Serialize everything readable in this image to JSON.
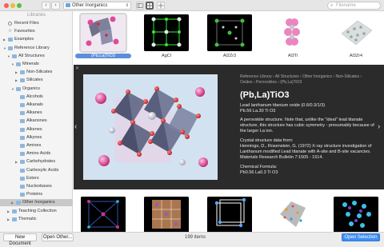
{
  "toolbar": {
    "back": "‹",
    "forward": "›",
    "location": "Other Inorganics",
    "search_placeholder": "Filename"
  },
  "sidebar": {
    "header": "Libraries",
    "items": [
      {
        "label": "Recent Files",
        "level": 0,
        "icon": "clock-icon"
      },
      {
        "label": "Favourites",
        "level": 0,
        "icon": "star-icon"
      },
      {
        "label": "Examples",
        "level": 0,
        "icon": "folder-icon",
        "collapsed": true
      },
      {
        "label": "Reference Library",
        "level": 0,
        "icon": "folder-icon",
        "expanded": true
      },
      {
        "label": "All Structures",
        "level": 1,
        "icon": "folder-icon",
        "expanded": true
      },
      {
        "label": "Minerals",
        "level": 2,
        "icon": "folder-icon",
        "expanded": true
      },
      {
        "label": "Non-Silicates",
        "level": 3,
        "icon": "folder-icon",
        "collapsed": true
      },
      {
        "label": "Silicates",
        "level": 3,
        "icon": "folder-icon",
        "collapsed": true
      },
      {
        "label": "Organics",
        "level": 2,
        "icon": "folder-icon",
        "expanded": true
      },
      {
        "label": "Alcohols",
        "level": 3,
        "icon": "folder-icon"
      },
      {
        "label": "Alkanals",
        "level": 3,
        "icon": "folder-icon"
      },
      {
        "label": "Alkanes",
        "level": 3,
        "icon": "folder-icon"
      },
      {
        "label": "Alkanones",
        "level": 3,
        "icon": "folder-icon"
      },
      {
        "label": "Alkenes",
        "level": 3,
        "icon": "folder-icon"
      },
      {
        "label": "Alkynes",
        "level": 3,
        "icon": "folder-icon"
      },
      {
        "label": "Amines",
        "level": 3,
        "icon": "folder-icon"
      },
      {
        "label": "Amino Acids",
        "level": 3,
        "icon": "folder-icon"
      },
      {
        "label": "Carbohydrates",
        "level": 3,
        "icon": "folder-icon",
        "collapsed": true
      },
      {
        "label": "Carboxylic Acids",
        "level": 3,
        "icon": "folder-icon"
      },
      {
        "label": "Esters",
        "level": 3,
        "icon": "folder-icon"
      },
      {
        "label": "Nucleobases",
        "level": 3,
        "icon": "folder-icon"
      },
      {
        "label": "Proteins",
        "level": 3,
        "icon": "folder-icon"
      },
      {
        "label": "Other Inorganics",
        "level": 2,
        "icon": "folder-icon",
        "selected": true,
        "collapsed": true
      },
      {
        "label": "Teaching Collection",
        "level": 1,
        "icon": "folder-icon",
        "collapsed": true
      },
      {
        "label": "Thematic",
        "level": 1,
        "icon": "folder-icon",
        "collapsed": true
      }
    ]
  },
  "thumbnails_top": [
    {
      "label": "(Pb,La)TiO3",
      "selected": true
    },
    {
      "label": "AgCl"
    },
    {
      "label": "Al2Zr3"
    },
    {
      "label": "Al3Ti"
    },
    {
      "label": "Al3Zr4"
    }
  ],
  "detail": {
    "breadcrumb": "Reference Library › All Structures › Other Inorganics › Non-Silicates › Oxides › Perovskites › (Pb,La)TiO3",
    "title": "(Pb,La)TiO3",
    "name_line1": "Lead lanthanum titanium oxide (0.6/0.3/1/3)",
    "name_line2": "Pb.56 La.30 Ti O3",
    "description": "A perovskite structure. Note that, unlike the \"ideal\" lead titanate structure, this structure has cubic symmetry - presumably because of the larger La ion.",
    "source_heading": "Crystal structure data from:",
    "source_text": "Hennings, D., Rosenstein, G. (1972)  X-ray structure investigation of Lanthanum modified Lead titanate with A-site  and B-site vacancies. Materials Research Bulletin 7:1505 - 1514.",
    "formula_heading": "Chemical Formula:",
    "formula": "Pb0.56 La0.3 Ti O3",
    "prev": "‹",
    "next": "›",
    "close": "✕"
  },
  "bottom": {
    "new_document": "New Document",
    "open_other": "Open Other...",
    "status": "199 items",
    "open_selection": "Open Selection"
  }
}
